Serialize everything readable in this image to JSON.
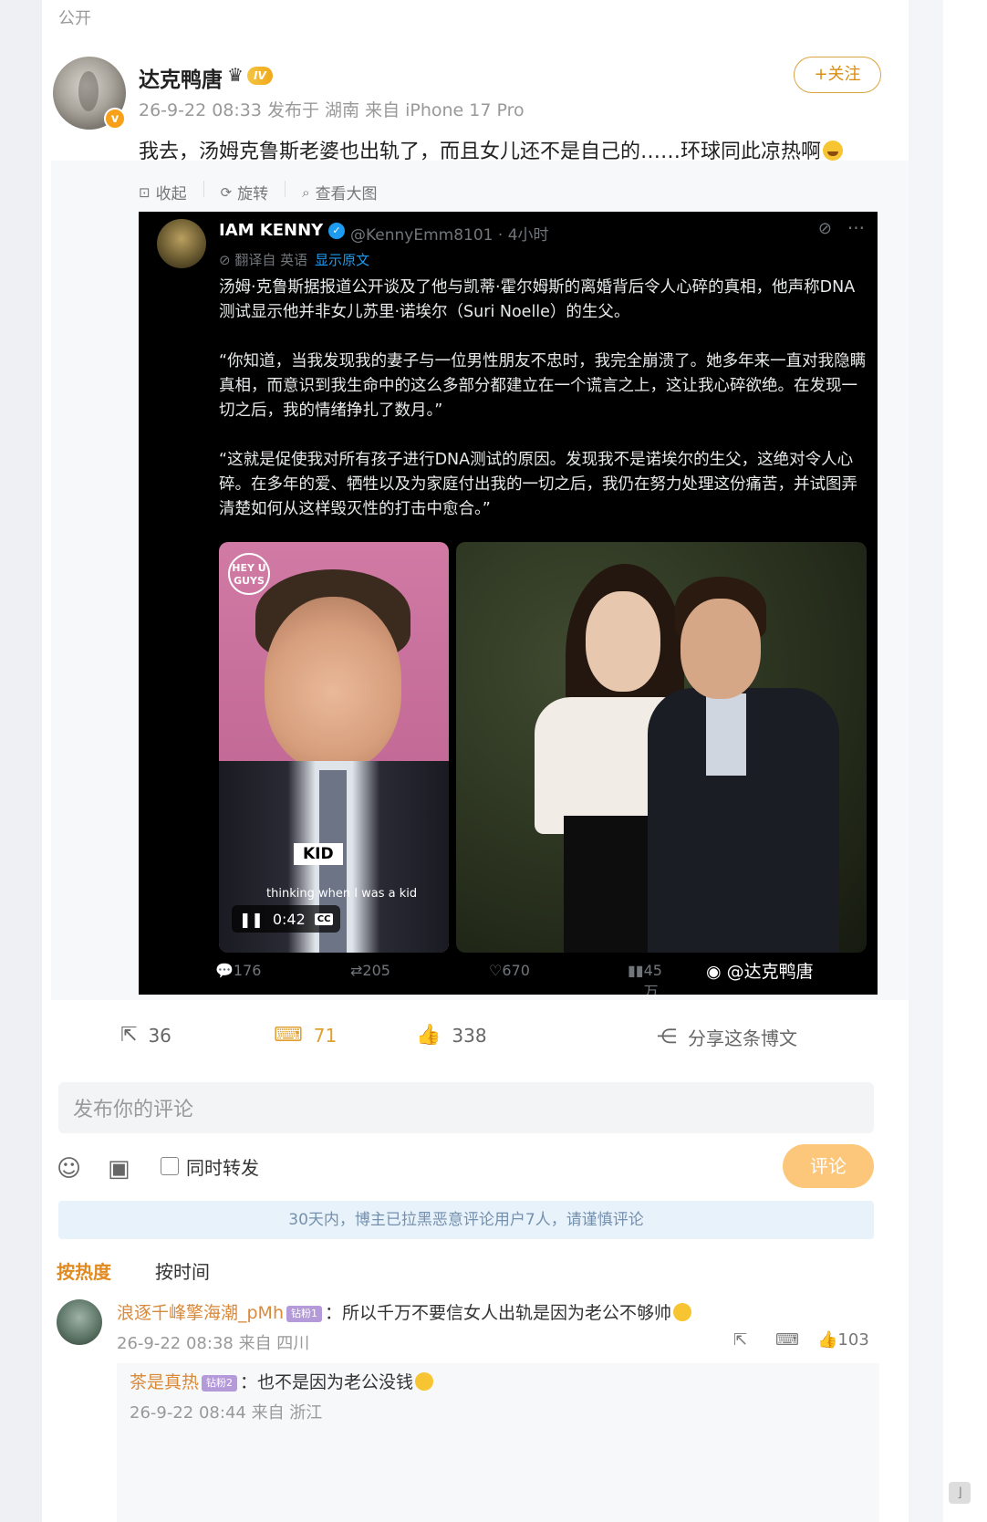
{
  "post": {
    "visibility": "公开",
    "author": "达克鸭唐",
    "vip_badge_icon": "crown-icon",
    "level": "IV",
    "verified_badge": "v",
    "meta": "26-9-22 08:33 发布于 湖南 来自 iPhone 17 Pro",
    "follow_label": "+关注",
    "text": "我去，汤姆克鲁斯老婆也出轨了，而且女儿还不是自己的……环球同此凉热啊"
  },
  "media_tools": {
    "collapse": "收起",
    "rotate": "旋转",
    "view_large": "查看大图"
  },
  "tweet": {
    "name": "IAM KENNY",
    "handle": "@KennyEmm8101 · 4小时",
    "translated_from": "翻译自 英语",
    "show_original": "显示原文",
    "para1": "汤姆·克鲁斯据报道公开谈及了他与凯蒂·霍尔姆斯的离婚背后令人心碎的真相，他声称DNA测试显示他并非女儿苏里·诺埃尔（Suri Noelle）的生父。",
    "para2": "“你知道，当我发现我的妻子与一位男性朋友不忠时，我完全崩溃了。她多年来一直对我隐瞒真相，而意识到我生命中的这么多部分都建立在一个谎言之上，这让我心碎欲绝。在发现一切之后，我的情绪挣扎了数月。”",
    "para3": "“这就是促使我对所有孩子进行DNA测试的原因。发现我不是诺埃尔的生父，这绝对令人心碎。在多年的爱、牺牲以及为家庭付出我的一切之后，我仍在努力处理这份痛苦，并试图弄清楚如何从这样毁灭性的打击中愈合。”",
    "video_logo": "HEY U GUYS",
    "caption_word": "KID",
    "subtitle": "thinking when I was a kid",
    "video_time": "0:42",
    "cc": "CC",
    "replies": "176",
    "retweets": "205",
    "likes": "670",
    "views": "45万",
    "watermark": "@达克鸭唐"
  },
  "actions": {
    "share_count": "36",
    "comment_count": "71",
    "like_count": "338",
    "share_post_label": "分享这条博文"
  },
  "comment_box": {
    "placeholder": "发布你的评论",
    "repost_label": "同时转发",
    "submit_label": "评论",
    "notice": "30天内，博主已拉黑恶意评论用户7人，请谨慎评论"
  },
  "sort": {
    "hot": "按热度",
    "time": "按时间"
  },
  "comments": [
    {
      "user": "浪逐千峰擎海潮_pMh",
      "badge": "钻粉1",
      "text": "：所以千万不要信女人出轨是因为老公不够帅",
      "meta": "26-9-22 08:38 来自 四川",
      "likes": "103",
      "reply": {
        "user": "茶是真热",
        "badge": "钻粉2",
        "text": "：也不是因为老公没钱",
        "meta": "26-9-22 08:44 来自 浙江"
      }
    }
  ]
}
